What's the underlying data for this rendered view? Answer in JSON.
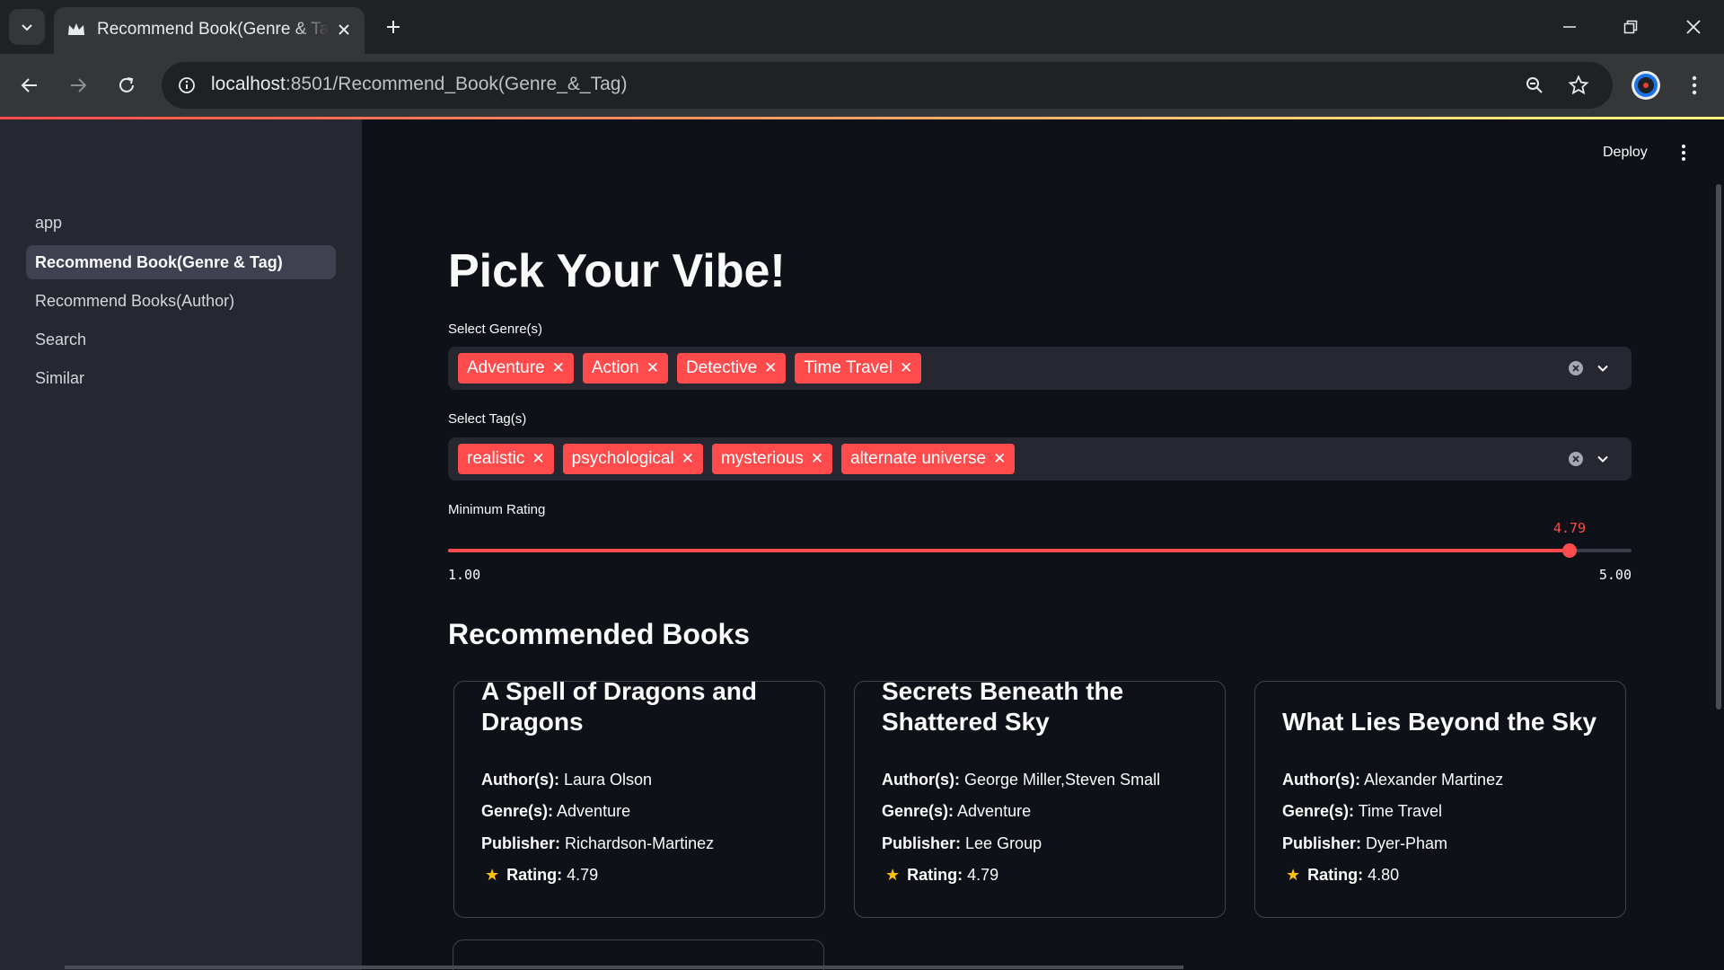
{
  "browser": {
    "tab_title": "Recommend Book(Genre & Tag)",
    "url_host": "localhost",
    "url_path": ":8501/Recommend_Book(Genre_&_Tag)"
  },
  "sidebar": {
    "items": [
      {
        "label": "app"
      },
      {
        "label": "Recommend Book(Genre & Tag)"
      },
      {
        "label": "Recommend Books(Author)"
      },
      {
        "label": "Search"
      },
      {
        "label": "Similar"
      }
    ]
  },
  "header": {
    "deploy_label": "Deploy"
  },
  "page": {
    "title": "Pick Your Vibe!",
    "genre_label": "Select Genre(s)",
    "genres": [
      "Adventure",
      "Action",
      "Detective",
      "Time Travel"
    ],
    "tag_label": "Select Tag(s)",
    "tags": [
      "realistic",
      "psychological",
      "mysterious",
      "alternate universe"
    ],
    "rating_label": "Minimum Rating",
    "rating_min": "1.00",
    "rating_max": "5.00",
    "rating_value": "4.79",
    "rating_fraction": 0.9475,
    "recommended_heading": "Recommended Books"
  },
  "books": [
    {
      "title_line1": "A Spell of Dragons and",
      "title_line2": "Dragons",
      "author_label": "Author(s):",
      "author": "Laura Olson",
      "genre_label": "Genre(s):",
      "genre": "Adventure",
      "publisher_label": "Publisher:",
      "publisher": "Richardson-Martinez",
      "rating_label": "Rating:",
      "rating": "4.79"
    },
    {
      "title_line1": "Secrets Beneath the",
      "title_line2": "Shattered Sky",
      "author_label": "Author(s):",
      "author": "George Miller,Steven Small",
      "genre_label": "Genre(s):",
      "genre": "Adventure",
      "publisher_label": "Publisher:",
      "publisher": "Lee Group",
      "rating_label": "Rating:",
      "rating": "4.79"
    },
    {
      "title_line1": "What Lies Beyond the Sky",
      "title_line2": "",
      "author_label": "Author(s):",
      "author": "Alexander Martinez",
      "genre_label": "Genre(s):",
      "genre": "Time Travel",
      "publisher_label": "Publisher:",
      "publisher": "Dyer-Pham",
      "rating_label": "Rating:",
      "rating": "4.80"
    }
  ],
  "colors": {
    "accent": "#ff4b4b",
    "background": "#0e1117",
    "sidebar": "#262730",
    "star": "#ffc107"
  },
  "icons": {
    "tab_menu": "chevron-down-icon",
    "favicon": "streamlit-crown-icon",
    "close": "close-icon",
    "new_tab": "plus-icon",
    "back": "arrow-left-icon",
    "forward": "arrow-right-icon",
    "reload": "reload-icon",
    "info": "info-icon",
    "zoom": "zoom-icon",
    "bookmark": "star-outline-icon",
    "profile": "profile-icon",
    "menu": "kebab-menu-icon"
  }
}
